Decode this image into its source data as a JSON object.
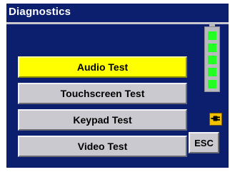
{
  "window": {
    "title": "Diagnostics"
  },
  "menu": {
    "items": [
      {
        "label": "Audio Test",
        "selected": true
      },
      {
        "label": "Touchscreen Test",
        "selected": false
      },
      {
        "label": "Keypad Test",
        "selected": false
      },
      {
        "label": "Video Test",
        "selected": false
      }
    ]
  },
  "status": {
    "battery_level": 1.0,
    "battery_segments_filled": 5,
    "battery_segments_total": 5,
    "battery_icon": "battery-icon",
    "power_icon": "power-plug-icon"
  },
  "actions": {
    "esc_label": "ESC"
  },
  "colors": {
    "panel_bg": "#0b1f6e",
    "button_bg": "#c9c9cf",
    "selected_bg": "#ffff00",
    "battery_segment": "#22ff22",
    "power_icon_bg": "#f2c200"
  }
}
